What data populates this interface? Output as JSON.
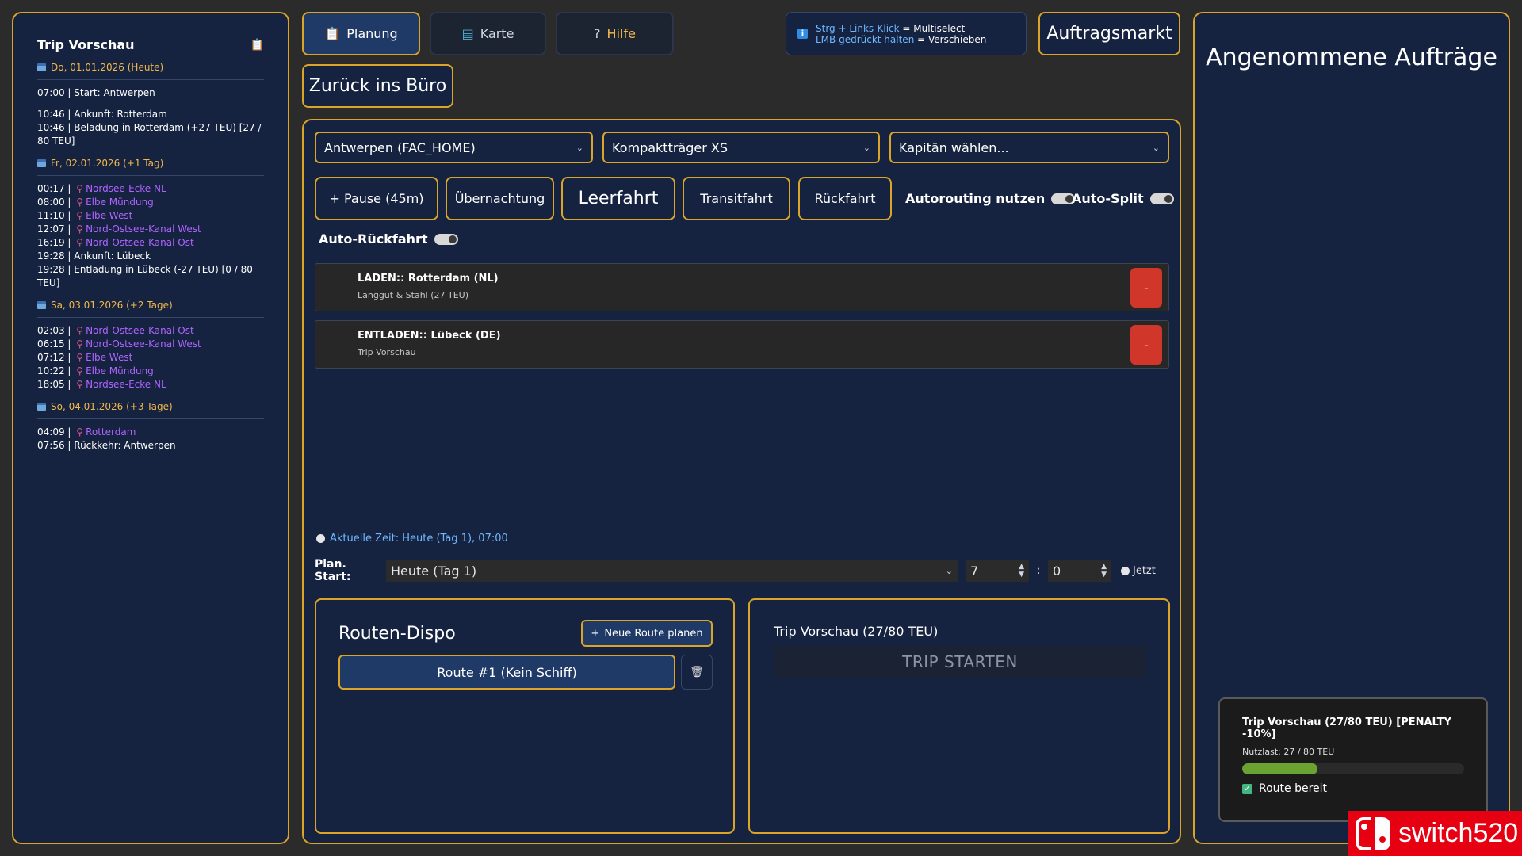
{
  "colors": {
    "accent_gold": "#d9a428",
    "panel_bg": "#152340",
    "waypoint": "#b064ff",
    "date": "#f2b84a",
    "danger": "#d0362a"
  },
  "left": {
    "title": "Trip Vorschau",
    "icon": "clipboard-icon",
    "days": [
      {
        "date": "Do, 01.01.2026 (Heute)",
        "entries": [
          {
            "time": "07:00",
            "text": "Start: Antwerpen",
            "wp": false
          },
          {
            "gap": true
          },
          {
            "time": "10:46",
            "text": "Ankunft: Rotterdam",
            "wp": false
          },
          {
            "time": "10:46",
            "text": "Beladung in Rotterdam (+27 TEU) [27 / 80 TEU]",
            "wp": false
          }
        ]
      },
      {
        "date": "Fr, 02.01.2026 (+1 Tag)",
        "entries": [
          {
            "time": "00:17",
            "text": "Nordsee-Ecke NL",
            "wp": true
          },
          {
            "time": "08:00",
            "text": "Elbe Mündung",
            "wp": true
          },
          {
            "time": "11:10",
            "text": "Elbe West",
            "wp": true
          },
          {
            "time": "12:07",
            "text": "Nord-Ostsee-Kanal West",
            "wp": true
          },
          {
            "time": "16:19",
            "text": "Nord-Ostsee-Kanal Ost",
            "wp": true
          },
          {
            "time": "19:28",
            "text": "Ankunft: Lübeck",
            "wp": false
          },
          {
            "time": "19:28",
            "text": "Entladung in Lübeck (-27 TEU) [0 / 80 TEU]",
            "wp": false
          }
        ]
      },
      {
        "date": "Sa, 03.01.2026 (+2 Tage)",
        "entries": [
          {
            "time": "02:03",
            "text": "Nord-Ostsee-Kanal Ost",
            "wp": true
          },
          {
            "time": "06:15",
            "text": "Nord-Ostsee-Kanal West",
            "wp": true
          },
          {
            "time": "07:12",
            "text": "Elbe West",
            "wp": true
          },
          {
            "time": "10:22",
            "text": "Elbe Mündung",
            "wp": true
          },
          {
            "time": "18:05",
            "text": "Nordsee-Ecke NL",
            "wp": true
          }
        ]
      },
      {
        "date": "So, 04.01.2026 (+3 Tage)",
        "entries": [
          {
            "time": "04:09",
            "text": "Rotterdam",
            "wp": true
          },
          {
            "time": "07:56",
            "text": "Rückkehr: Antwerpen",
            "wp": false
          }
        ]
      }
    ]
  },
  "tabs": {
    "planung": {
      "label": "Planung",
      "icon": "clipboard-icon"
    },
    "karte": {
      "label": "Karte",
      "icon": "map-icon"
    },
    "hilfe": {
      "label": "Hilfe",
      "icon": "question-icon"
    }
  },
  "hint": {
    "line1_key": "Strg + Links-Klick",
    "line1_rest": " = Multiselect",
    "line2_key": "LMB gedrückt halten",
    "line2_rest": " = Verschieben"
  },
  "market_button": "Auftragsmarkt",
  "back_button": "Zurück ins Büro",
  "selects": {
    "port": "Antwerpen (FAC_HOME)",
    "ship": "Kompaktträger XS",
    "captain": "Kapitän wählen..."
  },
  "actions": {
    "pause": "+ Pause (45m)",
    "overnight": "Übernachtung",
    "empty": "Leerfahrt",
    "transit": "Transitfahrt",
    "return": "Rückfahrt",
    "autorouting": "Autorouting nutzen",
    "autosplit": "Auto-Split",
    "autoreturn": "Auto-Rückfahrt"
  },
  "orders": [
    {
      "title": "LADEN:: Rotterdam (NL)",
      "sub": "Langgut & Stahl (27 TEU)",
      "remove": "-"
    },
    {
      "title": "ENTLADEN:: Lübeck (DE)",
      "sub": "Trip Vorschau",
      "remove": "-"
    }
  ],
  "time_now": "Aktuelle Zeit: Heute (Tag 1), 07:00",
  "plan": {
    "label": "Plan. Start:",
    "day": "Heute (Tag 1)",
    "hour": "7",
    "minute": "0",
    "colon": ":",
    "now": "Jetzt"
  },
  "dispo": {
    "title": "Routen-Dispo",
    "new_route": "Neue Route planen",
    "route": "Route #1 (Kein Schiff)"
  },
  "trip": {
    "title": "Trip Vorschau (27/80 TEU)",
    "start": "TRIP STARTEN"
  },
  "right": {
    "title": "Angenommene Aufträge",
    "card_title": "Trip Vorschau (27/80 TEU) [PENALTY -10%]",
    "card_load": "Nutzlast: 27 / 80 TEU",
    "load_fraction": 0.3375,
    "card_ready": "Route bereit"
  },
  "watermark": "switch520"
}
